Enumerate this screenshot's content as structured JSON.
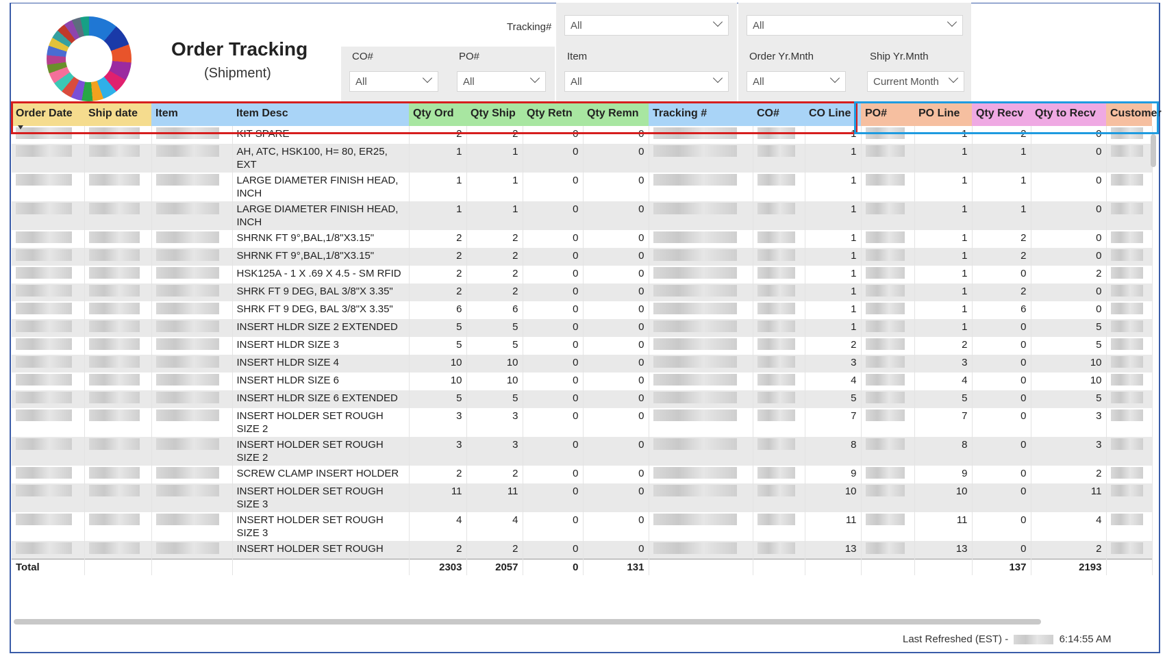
{
  "header": {
    "title": "Order Tracking",
    "subtitle": "(Shipment)"
  },
  "filters": {
    "tracking": {
      "label": "Tracking#",
      "value": "All",
      "value2": "All"
    },
    "co": {
      "label": "CO#",
      "value": "All"
    },
    "po": {
      "label": "PO#",
      "value": "All"
    },
    "item": {
      "label": "Item",
      "value": "All"
    },
    "order_yrmnth": {
      "label": "Order Yr.Mnth",
      "value": "All"
    },
    "ship_yrmnth": {
      "label": "Ship Yr.Mnth",
      "value": "Current Month"
    }
  },
  "columns": [
    "Order Date",
    "Ship date",
    "Item",
    "Item Desc",
    "Qty Ord",
    "Qty Ship",
    "Qty Retn",
    "Qty Remn",
    "Tracking #",
    "CO#",
    "CO Line",
    "PO#",
    "PO Line",
    "Qty Recv",
    "Qty to Recv",
    "Customer"
  ],
  "header_colors": {
    "yellow": "#f5dc8e",
    "blue": "#a9d4f7",
    "green": "#a8e6a1",
    "salmon": "#f6bfa0",
    "pink": "#efa9e3"
  },
  "rows": [
    {
      "desc": "KIT SPARE",
      "qty_ord": "2",
      "qty_ship": "2",
      "qty_retn": "0",
      "qty_remn": "0",
      "co_line": "1",
      "po_line": "1",
      "qty_recv": "2",
      "qty_to_recv": "0"
    },
    {
      "desc": "AH, ATC, HSK100, H= 80, ER25, EXT",
      "qty_ord": "1",
      "qty_ship": "1",
      "qty_retn": "0",
      "qty_remn": "0",
      "co_line": "1",
      "po_line": "1",
      "qty_recv": "1",
      "qty_to_recv": "0"
    },
    {
      "desc": "LARGE DIAMETER FINISH HEAD, INCH",
      "qty_ord": "1",
      "qty_ship": "1",
      "qty_retn": "0",
      "qty_remn": "0",
      "co_line": "1",
      "po_line": "1",
      "qty_recv": "1",
      "qty_to_recv": "0"
    },
    {
      "desc": "LARGE DIAMETER FINISH HEAD, INCH",
      "qty_ord": "1",
      "qty_ship": "1",
      "qty_retn": "0",
      "qty_remn": "0",
      "co_line": "1",
      "po_line": "1",
      "qty_recv": "1",
      "qty_to_recv": "0"
    },
    {
      "desc": "SHRNK FT 9°,BAL,1/8\"X3.15\"",
      "qty_ord": "2",
      "qty_ship": "2",
      "qty_retn": "0",
      "qty_remn": "0",
      "co_line": "1",
      "po_line": "1",
      "qty_recv": "2",
      "qty_to_recv": "0"
    },
    {
      "desc": "SHRNK FT 9°,BAL,1/8\"X3.15\"",
      "qty_ord": "2",
      "qty_ship": "2",
      "qty_retn": "0",
      "qty_remn": "0",
      "co_line": "1",
      "po_line": "1",
      "qty_recv": "2",
      "qty_to_recv": "0"
    },
    {
      "desc": "HSK125A - 1 X .69 X 4.5 - SM RFID",
      "qty_ord": "2",
      "qty_ship": "2",
      "qty_retn": "0",
      "qty_remn": "0",
      "co_line": "1",
      "po_line": "1",
      "qty_recv": "0",
      "qty_to_recv": "2"
    },
    {
      "desc": "SHRK FT 9 DEG, BAL 3/8\"X 3.35\"",
      "qty_ord": "2",
      "qty_ship": "2",
      "qty_retn": "0",
      "qty_remn": "0",
      "co_line": "1",
      "po_line": "1",
      "qty_recv": "2",
      "qty_to_recv": "0"
    },
    {
      "desc": "SHRK FT 9 DEG, BAL 3/8\"X 3.35\"",
      "qty_ord": "6",
      "qty_ship": "6",
      "qty_retn": "0",
      "qty_remn": "0",
      "co_line": "1",
      "po_line": "1",
      "qty_recv": "6",
      "qty_to_recv": "0"
    },
    {
      "desc": "INSERT HLDR SIZE 2 EXTENDED",
      "qty_ord": "5",
      "qty_ship": "5",
      "qty_retn": "0",
      "qty_remn": "0",
      "co_line": "1",
      "po_line": "1",
      "qty_recv": "0",
      "qty_to_recv": "5"
    },
    {
      "desc": "INSERT HLDR SIZE 3",
      "qty_ord": "5",
      "qty_ship": "5",
      "qty_retn": "0",
      "qty_remn": "0",
      "co_line": "2",
      "po_line": "2",
      "qty_recv": "0",
      "qty_to_recv": "5"
    },
    {
      "desc": "INSERT HLDR SIZE 4",
      "qty_ord": "10",
      "qty_ship": "10",
      "qty_retn": "0",
      "qty_remn": "0",
      "co_line": "3",
      "po_line": "3",
      "qty_recv": "0",
      "qty_to_recv": "10"
    },
    {
      "desc": "INSERT HLDR SIZE 6",
      "qty_ord": "10",
      "qty_ship": "10",
      "qty_retn": "0",
      "qty_remn": "0",
      "co_line": "4",
      "po_line": "4",
      "qty_recv": "0",
      "qty_to_recv": "10"
    },
    {
      "desc": "INSERT HLDR SIZE 6 EXTENDED",
      "qty_ord": "5",
      "qty_ship": "5",
      "qty_retn": "0",
      "qty_remn": "0",
      "co_line": "5",
      "po_line": "5",
      "qty_recv": "0",
      "qty_to_recv": "5"
    },
    {
      "desc": "INSERT HOLDER SET ROUGH SIZE 2",
      "qty_ord": "3",
      "qty_ship": "3",
      "qty_retn": "0",
      "qty_remn": "0",
      "co_line": "7",
      "po_line": "7",
      "qty_recv": "0",
      "qty_to_recv": "3"
    },
    {
      "desc": "INSERT HOLDER SET ROUGH SIZE 2",
      "qty_ord": "3",
      "qty_ship": "3",
      "qty_retn": "0",
      "qty_remn": "0",
      "co_line": "8",
      "po_line": "8",
      "qty_recv": "0",
      "qty_to_recv": "3"
    },
    {
      "desc": "SCREW CLAMP INSERT HOLDER",
      "qty_ord": "2",
      "qty_ship": "2",
      "qty_retn": "0",
      "qty_remn": "0",
      "co_line": "9",
      "po_line": "9",
      "qty_recv": "0",
      "qty_to_recv": "2"
    },
    {
      "desc": "INSERT HOLDER SET ROUGH SIZE 3",
      "qty_ord": "11",
      "qty_ship": "11",
      "qty_retn": "0",
      "qty_remn": "0",
      "co_line": "10",
      "po_line": "10",
      "qty_recv": "0",
      "qty_to_recv": "11"
    },
    {
      "desc": "INSERT HOLDER SET ROUGH SIZE 3",
      "qty_ord": "4",
      "qty_ship": "4",
      "qty_retn": "0",
      "qty_remn": "0",
      "co_line": "11",
      "po_line": "11",
      "qty_recv": "0",
      "qty_to_recv": "4"
    },
    {
      "desc": "INSERT HOLDER SET ROUGH",
      "qty_ord": "2",
      "qty_ship": "2",
      "qty_retn": "0",
      "qty_remn": "0",
      "co_line": "13",
      "po_line": "13",
      "qty_recv": "0",
      "qty_to_recv": "2"
    }
  ],
  "totals": {
    "label": "Total",
    "qty_ord": "2303",
    "qty_ship": "2057",
    "qty_retn": "0",
    "qty_remn": "131",
    "qty_recv": "137",
    "qty_to_recv": "2193"
  },
  "footer": {
    "refreshed_label": "Last Refreshed (EST) -",
    "refreshed_time": "6:14:55 AM"
  }
}
